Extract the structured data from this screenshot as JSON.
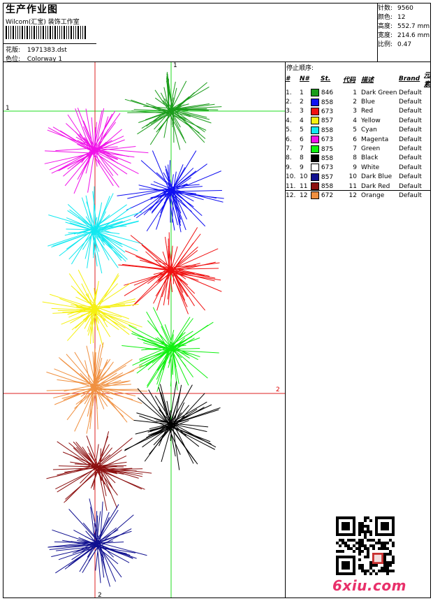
{
  "header": {
    "title": "生产作业图",
    "company": "Wilcom(汇宝) 装饰工作室",
    "design_label": "花版:",
    "design_value": "1971383.dst",
    "colorway_label": "色位:",
    "colorway_value": "Colorway 1"
  },
  "stats": [
    {
      "label": "针数:",
      "value": "9560"
    },
    {
      "label": "颜色:",
      "value": "12"
    },
    {
      "label": "高度:",
      "value": "552.7 mm"
    },
    {
      "label": "宽度:",
      "value": "214.6 mm"
    },
    {
      "label": "比例:",
      "value": "0.47"
    }
  ],
  "stop_sequence": {
    "label": "停止顺序:",
    "columns": [
      "#",
      "N#",
      "St.",
      "代码",
      "描述",
      "Brand",
      "元素"
    ],
    "rows": [
      {
        "idx": "1.",
        "n": "1",
        "color": "#1a9c1a",
        "st": "846",
        "code": "1",
        "desc": "Dark Green",
        "brand": "Default"
      },
      {
        "idx": "2.",
        "n": "2",
        "color": "#1010f0",
        "st": "858",
        "code": "2",
        "desc": "Blue",
        "brand": "Default"
      },
      {
        "idx": "3.",
        "n": "3",
        "color": "#f01010",
        "st": "673",
        "code": "3",
        "desc": "Red",
        "brand": "Default"
      },
      {
        "idx": "4.",
        "n": "4",
        "color": "#f5f010",
        "st": "857",
        "code": "4",
        "desc": "Yellow",
        "brand": "Default"
      },
      {
        "idx": "5.",
        "n": "5",
        "color": "#10e8f0",
        "st": "858",
        "code": "5",
        "desc": "Cyan",
        "brand": "Default"
      },
      {
        "idx": "6.",
        "n": "6",
        "color": "#f010e8",
        "st": "673",
        "code": "6",
        "desc": "Magenta",
        "brand": "Default"
      },
      {
        "idx": "7.",
        "n": "7",
        "color": "#10f010",
        "st": "875",
        "code": "7",
        "desc": "Green",
        "brand": "Default"
      },
      {
        "idx": "8.",
        "n": "8",
        "color": "#000000",
        "st": "858",
        "code": "8",
        "desc": "Black",
        "brand": "Default"
      },
      {
        "idx": "9.",
        "n": "9",
        "color": "#ffffff",
        "st": "673",
        "code": "9",
        "desc": "White",
        "brand": "Default"
      },
      {
        "idx": "10.",
        "n": "10",
        "color": "#101090",
        "st": "857",
        "code": "10",
        "desc": "Dark Blue",
        "brand": "Default"
      },
      {
        "idx": "11.",
        "n": "11",
        "color": "#8c1010",
        "st": "858",
        "code": "11",
        "desc": "Dark Red",
        "brand": "Default"
      },
      {
        "idx": "12.",
        "n": "12",
        "color": "#f09040",
        "st": "672",
        "code": "12",
        "desc": "Orange",
        "brand": "Default"
      }
    ]
  },
  "axes": {
    "green_label": "1",
    "red_label": "2"
  },
  "watermark": "6xiu.com"
}
